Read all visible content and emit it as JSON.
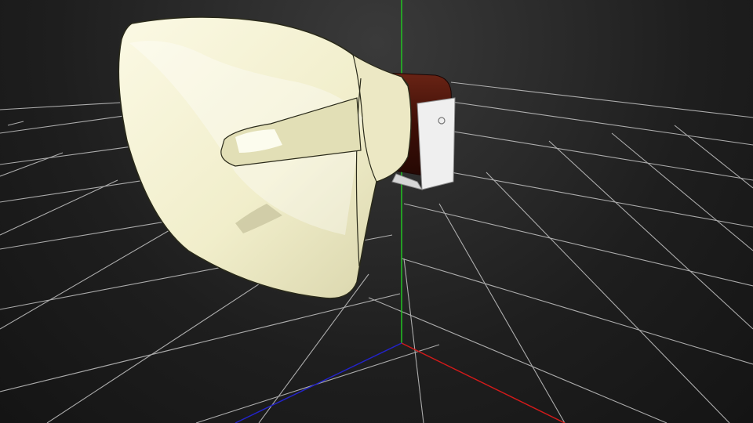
{
  "viewport": {
    "background_top": "#3a3a3a",
    "background_bottom": "#141414",
    "grid_color": "#d9d9d9",
    "axis_colors": {
      "x": "#d21a1a",
      "y": "#22c322",
      "z": "#2323c8"
    }
  },
  "model": {
    "name": "horn-speaker",
    "horn_color": "#f3f0cf",
    "horn_shadow_color": "#d9d6b0",
    "driver_color": "#4a1208",
    "bracket_color": "#eeeeee"
  },
  "icons": [
    "horn-speaker-icon",
    "mounting-bracket-icon",
    "axis-gizmo-icon"
  ]
}
